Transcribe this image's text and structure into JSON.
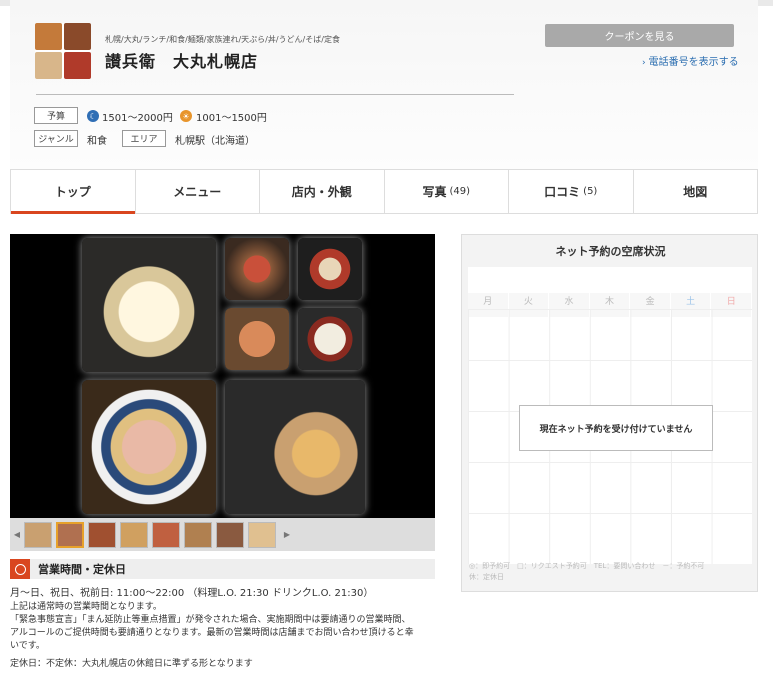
{
  "header": {
    "tags": "札幌/大丸/ランチ/和食/麺類/家族連れ/天ぷら/丼/うどん/そば/定食",
    "shop_name": "讃兵衛　大丸札幌店",
    "coupon_label": "クーポンを見る",
    "phone_label": "電話番号を表示する",
    "budget_label": "予算",
    "budget_dinner": "1501～2000円",
    "budget_lunch": "1001～1500円",
    "genre_label": "ジャンル",
    "genre_value": "和食",
    "area_label": "エリア",
    "area_value": "札幌駅（北海道）",
    "colors": {
      "dinner": "#2f6eb5",
      "lunch": "#e8952b"
    }
  },
  "tabs": [
    {
      "label": "トップ",
      "count": ""
    },
    {
      "label": "メニュー",
      "count": ""
    },
    {
      "label": "店内・外観",
      "count": ""
    },
    {
      "label": "写真",
      "count": "(49)"
    },
    {
      "label": "口コミ",
      "count": "(5)"
    },
    {
      "label": "地図",
      "count": ""
    }
  ],
  "hours": {
    "title": "営業時間・定休日",
    "line1": "月～日、祝日、祝前日: 11:00～22:00 （料理L.O. 21:30 ドリンクL.O. 21:30）",
    "line2": "上記は通常時の営業時間となります。",
    "line3": "「緊急事態宣言」「まん延防止等重点措置」が発令された場合、実施期間中は要請通りの営業時間、",
    "line4": "アルコールのご提供時間も要請通りとなります。最新の営業時間は店舗までお問い合わせ頂けると幸",
    "line5": "いです。",
    "line6": "定休日：不定休：大丸札幌店の休館日に準ずる形となります"
  },
  "reservation": {
    "title": "ネット予約の空席状況",
    "days": [
      "月",
      "火",
      "水",
      "木",
      "金",
      "土",
      "日"
    ],
    "message": "現在ネット予約を受け付けていません",
    "legend1": "◎：即予約可　□：リクエスト予約可　TEL：要問い合わせ　－：予約不可",
    "legend2": "休：定休日"
  }
}
